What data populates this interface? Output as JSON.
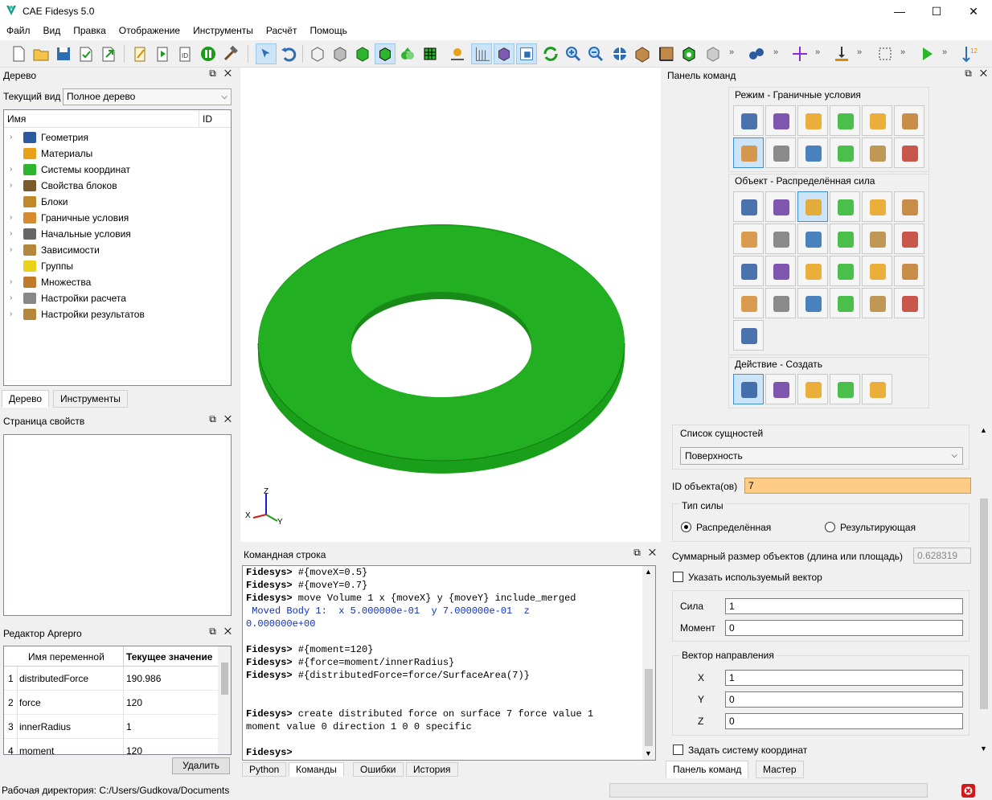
{
  "window": {
    "title": "CAE Fidesys 5.0",
    "min": "—",
    "max": "☐",
    "close": "✕"
  },
  "menu": [
    "Файл",
    "Вид",
    "Правка",
    "Отображение",
    "Инструменты",
    "Расчёт",
    "Помощь"
  ],
  "tree_panel": {
    "title": "Дерево",
    "view_label": "Текущий вид",
    "view_value": "Полное дерево",
    "col_name": "Имя",
    "col_id": "ID",
    "items": [
      {
        "label": "Геометрия",
        "icon": "geometry-icon",
        "expandable": true
      },
      {
        "label": "Материалы",
        "icon": "materials-icon",
        "expandable": false
      },
      {
        "label": "Системы координат",
        "icon": "coordinate-systems-icon",
        "expandable": true
      },
      {
        "label": "Свойства блоков",
        "icon": "block-properties-icon",
        "expandable": true
      },
      {
        "label": "Блоки",
        "icon": "blocks-icon",
        "expandable": false
      },
      {
        "label": "Граничные условия",
        "icon": "boundary-conditions-icon",
        "expandable": true
      },
      {
        "label": "Начальные условия",
        "icon": "initial-conditions-icon",
        "expandable": true
      },
      {
        "label": "Зависимости",
        "icon": "dependencies-icon",
        "expandable": true
      },
      {
        "label": "Группы",
        "icon": "groups-icon",
        "expandable": false
      },
      {
        "label": "Множества",
        "icon": "sets-icon",
        "expandable": true
      },
      {
        "label": "Настройки расчета",
        "icon": "calc-settings-icon",
        "expandable": true
      },
      {
        "label": "Настройки результатов",
        "icon": "result-settings-icon",
        "expandable": true
      }
    ],
    "tabs": [
      "Дерево",
      "Инструменты"
    ]
  },
  "properties_panel": {
    "title": "Страница свойств"
  },
  "aprepro": {
    "title": "Редактор Aprepro",
    "col_name": "Имя переменной",
    "col_value": "Текущее значение",
    "rows": [
      {
        "n": "1",
        "name": "distributedForce",
        "value": "190.986"
      },
      {
        "n": "2",
        "name": "force",
        "value": "120"
      },
      {
        "n": "3",
        "name": "innerRadius",
        "value": "1"
      },
      {
        "n": "4",
        "name": "moment",
        "value": "120"
      }
    ],
    "delete_label": "Удалить"
  },
  "viewport": {
    "axes": {
      "x": "X",
      "y": "Y",
      "z": "Z"
    },
    "model_color": "#22b022"
  },
  "command_panel_title": "Командная строка",
  "command_lines": [
    {
      "prompt": "Fidesys>",
      "text": " #{moveX=0.5}",
      "type": "cmd"
    },
    {
      "prompt": "Fidesys>",
      "text": " #{moveY=0.7}",
      "type": "cmd"
    },
    {
      "prompt": "Fidesys>",
      "text": " move Volume 1 x {moveX} y {moveY} include_merged",
      "type": "cmd"
    },
    {
      "prompt": "",
      "text": " Moved Body 1:  x 5.000000e-01  y 7.000000e-01  z",
      "type": "out"
    },
    {
      "prompt": "",
      "text": "0.000000e+00",
      "type": "out"
    },
    {
      "prompt": "",
      "text": "",
      "type": "blank"
    },
    {
      "prompt": "Fidesys>",
      "text": " #{moment=120}",
      "type": "cmd"
    },
    {
      "prompt": "Fidesys>",
      "text": " #{force=moment/innerRadius}",
      "type": "cmd"
    },
    {
      "prompt": "Fidesys>",
      "text": " #{distributedForce=force/SurfaceArea(7)}",
      "type": "cmd"
    },
    {
      "prompt": "",
      "text": "",
      "type": "blank"
    },
    {
      "prompt": "",
      "text": "",
      "type": "blank"
    },
    {
      "prompt": "Fidesys>",
      "text": " create distributed force on surface 7 force value 1",
      "type": "cmd"
    },
    {
      "prompt": "",
      "text": "moment value 0 direction 1 0 0 specific",
      "type": "plain"
    },
    {
      "prompt": "",
      "text": "",
      "type": "blank"
    },
    {
      "prompt": "Fidesys>",
      "text": "",
      "type": "cmd"
    }
  ],
  "command_tabs": [
    "Python",
    "Команды",
    "Ошибки",
    "История"
  ],
  "right_panel": {
    "title": "Панель команд",
    "mode_label": "Режим - Граничные условия",
    "object_label": "Объект - Распределённая сила",
    "action_label": "Действие - Создать",
    "entity_list_label": "Список сущностей",
    "entity_value": "Поверхность",
    "object_id_label": "ID объекта(ов)",
    "object_id_value": "7",
    "force_type_label": "Тип силы",
    "radio_distributed": "Распределённая",
    "radio_resulting": "Результирующая",
    "total_size_label": "Суммарный размер объектов (длина или площадь)",
    "total_size_value": "0.628319",
    "use_vector_label": "Указать используемый вектор",
    "force_label": "Сила",
    "force_value": "1",
    "moment_label": "Момент",
    "moment_value": "0",
    "direction_label": "Вектор направления",
    "x_label": "X",
    "x_value": "1",
    "y_label": "Y",
    "y_value": "0",
    "z_label": "Z",
    "z_value": "0",
    "set_cs_label": "Задать систему координат",
    "tabs": [
      "Панель команд",
      "Мастер"
    ]
  },
  "status": {
    "workdir": "Рабочая директория: C:/Users/Gudkova/Documents"
  }
}
